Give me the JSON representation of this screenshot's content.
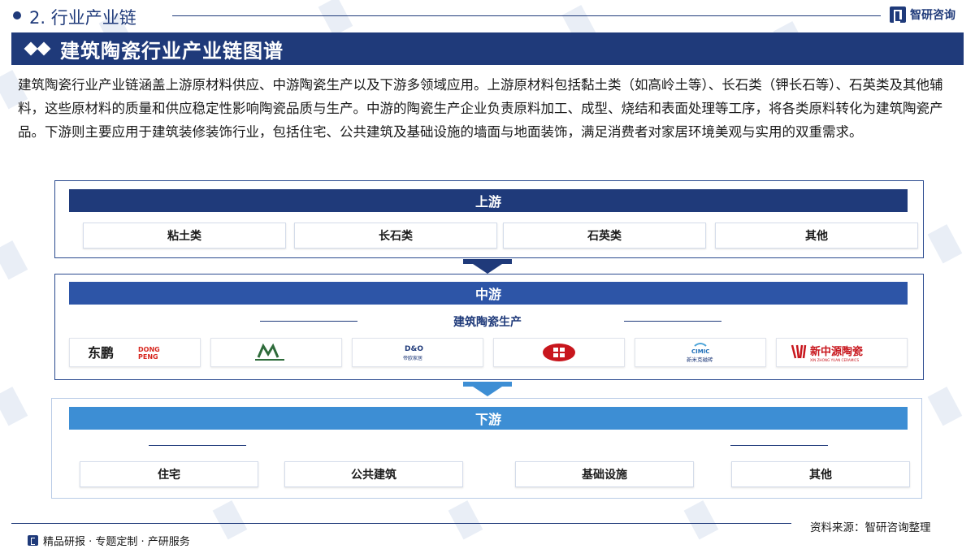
{
  "header": {
    "section_label": "2. 行业产业链",
    "brand_name": "智研咨询"
  },
  "title": "建筑陶瓷行业产业链图谱",
  "intro": "建筑陶瓷行业产业链涵盖上游原材料供应、中游陶瓷生产以及下游多领域应用。上游原材料包括黏土类（如高岭土等）、长石类（钾长石等）、石英类及其他辅料，这些原材料的质量和供应稳定性影响陶瓷品质与生产。中游的陶瓷生产企业负责原料加工、成型、烧结和表面处理等工序，将各类原料转化为建筑陶瓷产品。下游则主要应用于建筑装修装饰行业，包括住宅、公共建筑及基础设施的墙面与地面装饰，满足消费者对家居环境美观与实用的双重需求。",
  "upstream": {
    "label": "上游",
    "items": [
      "粘土类",
      "长石类",
      "石英类",
      "其他"
    ]
  },
  "midstream": {
    "label": "中游",
    "sub_label": "建筑陶瓷生产",
    "logos": [
      {
        "cn": "东鹏",
        "en": "DONGPENG",
        "color": "#d7261e"
      },
      {
        "en": "MARCOPOLO",
        "color": "#2e6b3a"
      },
      {
        "en": "D&O",
        "cn": "帝欧家居",
        "color": "#1f3a7a"
      },
      {
        "color": "#c8161d"
      },
      {
        "en": "CIMIC",
        "cn": "新米克磁砖",
        "color": "#1f6fb8"
      },
      {
        "cn": "新中源陶瓷",
        "en": "XIN ZHONG YUAN CERAMICS",
        "color": "#c8161d"
      }
    ]
  },
  "downstream": {
    "label": "下游",
    "items": [
      "住宅",
      "公共建筑",
      "基础设施",
      "其他"
    ]
  },
  "footer": {
    "source": "资料来源：智研咨询整理",
    "slogan": "精品研报 · 专题定制 · 产研服务"
  },
  "colors": {
    "primary": "#1f3a7a",
    "mid_band": "#2d55a7",
    "down_band": "#3d8ed4"
  }
}
